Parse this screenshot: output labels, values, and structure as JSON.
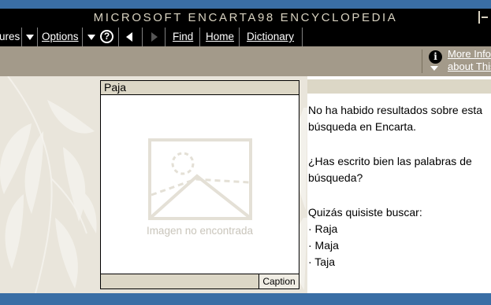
{
  "window": {
    "title": "MICROSOFT ENCARTA98 ENCYCLOPEDIA"
  },
  "toolbar": {
    "features_label": "ures",
    "options_label": "Options",
    "find_label": "Find",
    "home_label": "Home",
    "dictionary_label": "Dictionary",
    "help_glyph": "?"
  },
  "infobar": {
    "info_glyph": "i",
    "more_info_line1": "More Info",
    "more_info_line2": "about This"
  },
  "media": {
    "title": "Paja",
    "not_found": "Imagen no encontrada",
    "caption_label": "Caption"
  },
  "results": {
    "no_results": "No ha habido resultados sobre esta búsqueda en Encarta.",
    "spell_check": "¿Has escrito bien las palabras de búsqueda?",
    "did_you_mean": "Quizás quisiste buscar:",
    "suggestions": [
      "· Raja",
      "· Maja",
      "· Taja"
    ]
  },
  "colors": {
    "frame_blue": "#3a6ea5",
    "bar_black": "#000000",
    "info_band": "#a39a8a",
    "panel_beige": "#dcd7c6"
  }
}
